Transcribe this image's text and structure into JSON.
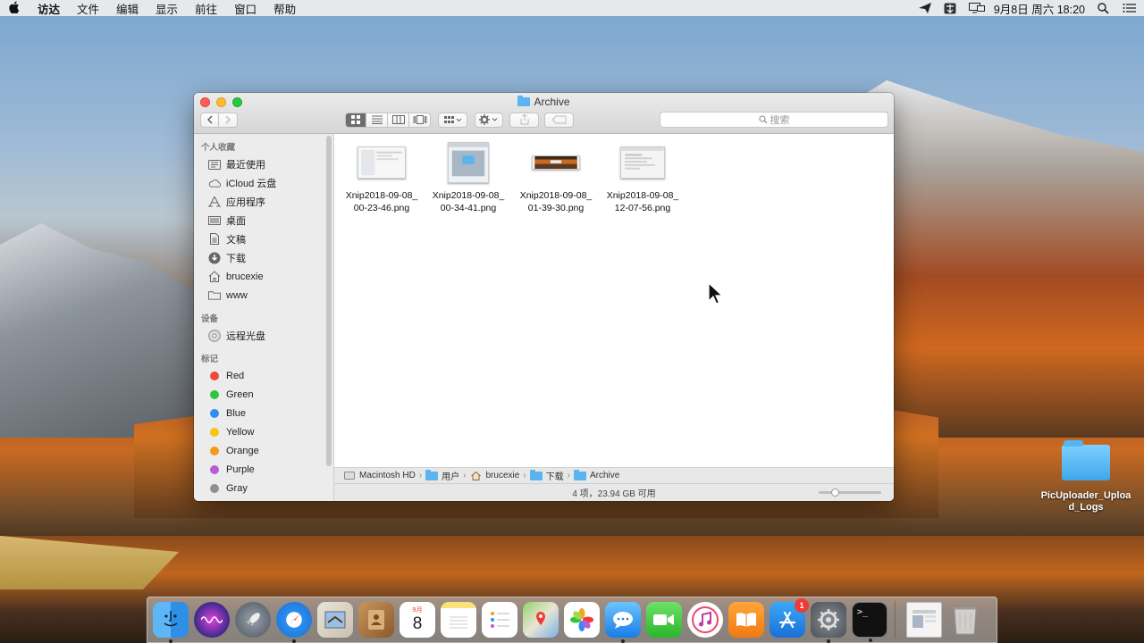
{
  "menubar": {
    "items": [
      "访达",
      "文件",
      "编辑",
      "显示",
      "前往",
      "窗口",
      "帮助"
    ],
    "clock": "9月8日 周六 18:20"
  },
  "window": {
    "title": "Archive",
    "search_placeholder": "搜索"
  },
  "sidebar": {
    "favorites_label": "个人收藏",
    "favorites": [
      "最近使用",
      "iCloud 云盘",
      "应用程序",
      "桌面",
      "文稿",
      "下载",
      "brucexie",
      "www"
    ],
    "devices_label": "设备",
    "devices": [
      "远程光盘"
    ],
    "tags_label": "标记",
    "tags": [
      {
        "name": "Red",
        "color": "#f0473d"
      },
      {
        "name": "Green",
        "color": "#31c53b"
      },
      {
        "name": "Blue",
        "color": "#2f8ef5"
      },
      {
        "name": "Yellow",
        "color": "#f5c614"
      },
      {
        "name": "Orange",
        "color": "#f39a1a"
      },
      {
        "name": "Purple",
        "color": "#b95ad6"
      },
      {
        "name": "Gray",
        "color": "#8f8f8f"
      }
    ]
  },
  "files": [
    {
      "line1": "Xnip2018-09-08_",
      "line2": "00-23-46.png"
    },
    {
      "line1": "Xnip2018-09-08_",
      "line2": "00-34-41.png"
    },
    {
      "line1": "Xnip2018-09-08_",
      "line2": "01-39-30.png"
    },
    {
      "line1": "Xnip2018-09-08_",
      "line2": "12-07-56.png"
    }
  ],
  "pathbar": [
    "Macintosh HD",
    "用户",
    "brucexie",
    "下载",
    "Archive"
  ],
  "status": "4 项，23.94 GB 可用",
  "desktop_folder": {
    "line1": "PicUploader_Uploa",
    "line2": "d_Logs"
  },
  "dock": {
    "calendar_month": "9月",
    "calendar_day": "8",
    "appstore_badge": "1",
    "terminal_prompt": ">_"
  }
}
